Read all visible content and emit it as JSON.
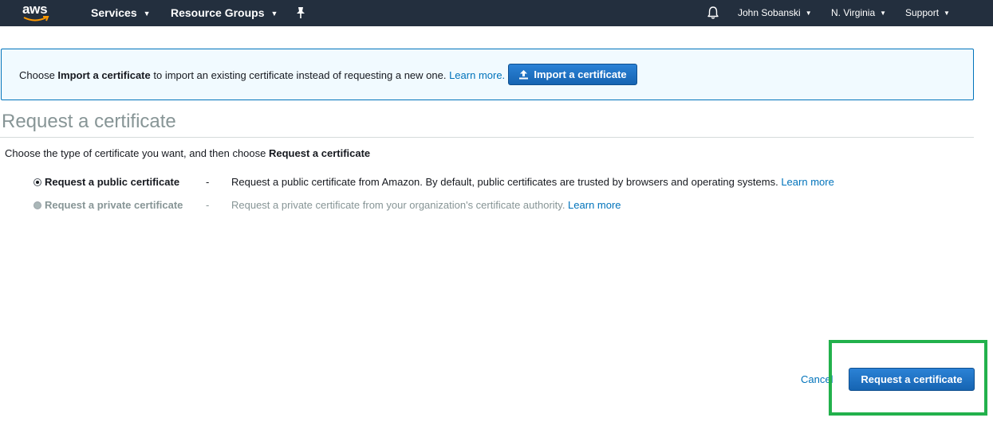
{
  "topnav": {
    "logo_text": "aws",
    "services_label": "Services",
    "resource_groups_label": "Resource Groups",
    "user_label": "John Sobanski",
    "region_label": "N. Virginia",
    "support_label": "Support",
    "caret": "▼",
    "background_color": "#232f3e"
  },
  "banner": {
    "text_before": "Choose ",
    "text_bold": "Import a certificate",
    "text_after": " to import an existing certificate instead of requesting a new one. ",
    "learn_more": "Learn more.",
    "import_button_label": "Import a certificate",
    "import_icon": "upload-icon"
  },
  "page": {
    "title": "Request a certificate",
    "instruction_before": "Choose the type of certificate you want, and then choose ",
    "instruction_bold": "Request a certificate"
  },
  "options": [
    {
      "label": "Request a public certificate",
      "dash": "-",
      "description": "Request a public certificate from Amazon. By default, public certificates are trusted by browsers and operating systems. ",
      "learn_more": "Learn more",
      "selected": true
    },
    {
      "label": "Request a private certificate",
      "dash": "-",
      "description": "Request a private certificate from your organization's certificate authority. ",
      "learn_more": "Learn more",
      "selected": false
    }
  ],
  "footer": {
    "cancel_label": "Cancel",
    "request_button_label": "Request a certificate"
  },
  "colors": {
    "primary_button": "#1a6fc0",
    "link": "#0073bb",
    "banner_bg": "#f1faff",
    "highlight": "#22b14c"
  }
}
